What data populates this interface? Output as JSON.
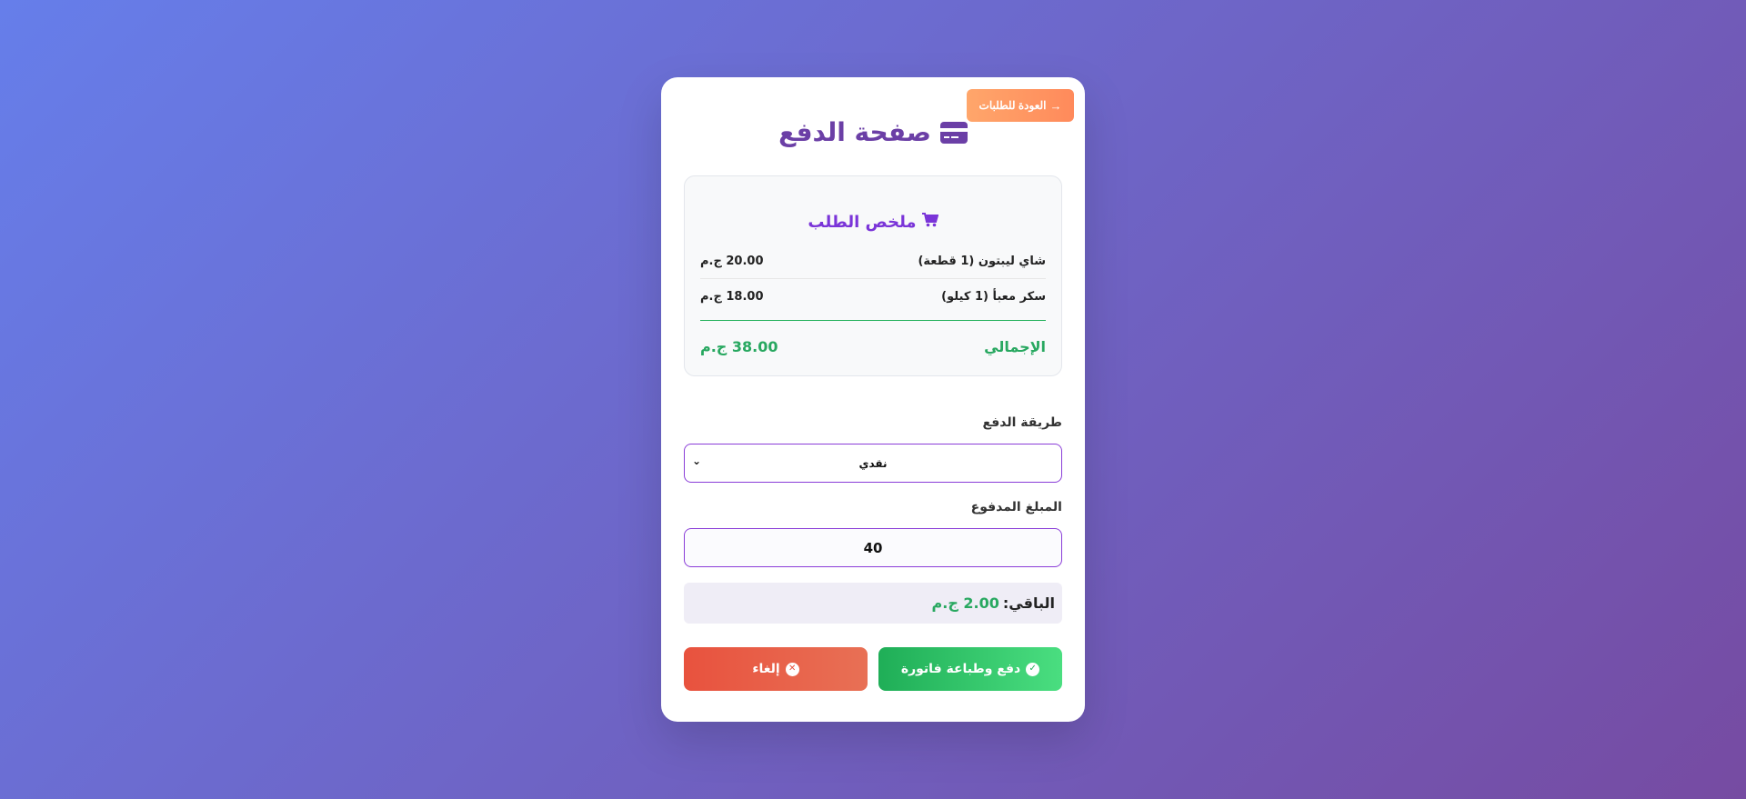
{
  "header": {
    "back_label": "العودة للطلبات",
    "title": "صفحة الدفع",
    "title_icon": "credit-card-icon"
  },
  "summary": {
    "title": "ملخص الطلب",
    "title_icon": "shopping-cart-icon",
    "items": [
      {
        "name": "شاي ليبتون (1 قطعة)",
        "price": "20.00 ج.م"
      },
      {
        "name": "سكر معبأ (1 كيلو)",
        "price": "18.00 ج.م"
      }
    ],
    "total_label": "الإجمالي",
    "total_value": "38.00 ج.م"
  },
  "payment": {
    "method_label": "طريقة الدفع",
    "method_value": "نقدي",
    "amount_label": "المبلغ المدفوع",
    "amount_value": "40",
    "remaining_label": "الباقي:",
    "remaining_value": "2.00 ج.م"
  },
  "actions": {
    "pay_label": "دفع وطباعة فاتورة",
    "cancel_label": "إلغاء"
  },
  "colors": {
    "background_start": "#667eea",
    "background_end": "#764ba2",
    "title": "#6b3fa6",
    "accent_purple": "#7a34d8",
    "success_green": "#28a860",
    "danger_red": "#e8523e",
    "back_orange": "#ff8a5b"
  }
}
